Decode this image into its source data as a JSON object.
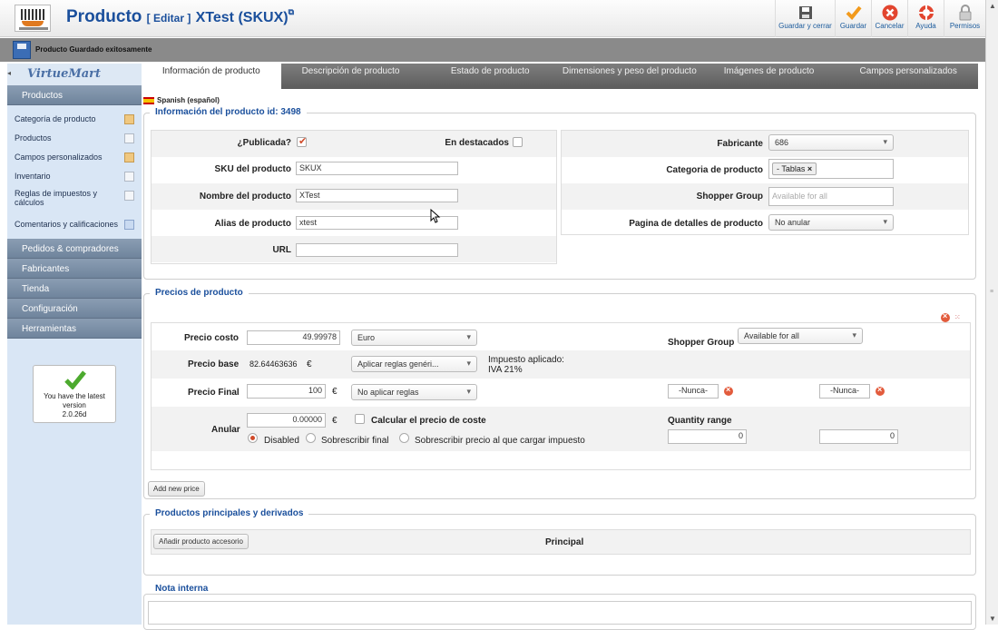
{
  "header": {
    "title": "Producto",
    "edit": "[ Editar ]",
    "product": "XTest (SKUX)",
    "toolbar": [
      {
        "label": "Guardar y cerrar",
        "icon": "save-close-icon"
      },
      {
        "label": "Guardar",
        "icon": "save-check-icon"
      },
      {
        "label": "Cancelar",
        "icon": "cancel-icon"
      },
      {
        "label": "Ayuda",
        "icon": "help-icon"
      },
      {
        "label": "Permisos",
        "icon": "lock-icon"
      }
    ]
  },
  "message": "Producto Guardado exitosamente",
  "sidebar": {
    "logo": "VirtueMart",
    "section_productos": "Productos",
    "items": [
      {
        "label": "Categoría de producto"
      },
      {
        "label": "Productos"
      },
      {
        "label": "Campos personalizados"
      },
      {
        "label": "Inventario"
      },
      {
        "label": "Reglas de impuestos y cálculos"
      },
      {
        "label": "Comentarios y calificaciones"
      }
    ],
    "sections": [
      "Pedidos & compradores",
      "Fabricantes",
      "Tienda",
      "Configuración",
      "Herramientas"
    ],
    "version_box": {
      "line1": "You have the latest",
      "line2": "version",
      "line3": "2.0.26d"
    }
  },
  "tabs": [
    "Información de producto",
    "Descripción de producto",
    "Estado de producto",
    "Dimensiones y peso del producto",
    "Imágenes de producto",
    "Campos personalizados"
  ],
  "info": {
    "language": "Spanish (español)",
    "legend": "Información del producto id: 3498",
    "publicada_label": "¿Publicada?",
    "destacados_label": "En destacados",
    "sku_label": "SKU del producto",
    "sku_value": "SKUX",
    "nombre_label": "Nombre del producto",
    "nombre_value": "XTest",
    "alias_label": "Alias de producto",
    "alias_value": "xtest",
    "url_label": "URL",
    "url_value": "",
    "fabricante_label": "Fabricante",
    "fabricante_value": "686",
    "categoria_label": "Categoria de producto",
    "categoria_tag": "- Tablas",
    "shopper_label": "Shopper Group",
    "shopper_placeholder": "Available for all",
    "pagina_label": "Pagina de detalles de producto",
    "pagina_value": "No anular"
  },
  "prices": {
    "legend": "Precios de producto",
    "costo_label": "Precio costo",
    "costo_value": "49.99978",
    "currency": "Euro",
    "shopper_label": "Shopper Group",
    "shopper_value": "Available for all",
    "base_label": "Precio base",
    "base_value": "82.64463636",
    "euro": "€",
    "base_rule": "Aplicar reglas genéri...",
    "tax_label": "Impuesto aplicado:",
    "tax_value": "IVA 21%",
    "final_label": "Precio Final",
    "final_value": "100",
    "final_rule": "No aplicar reglas",
    "nunca1": "-Nunca-",
    "nunca2": "-Nunca-",
    "anular_label": "Anular",
    "anular_value": "0.00000",
    "calc_label": "Calcular el precio de coste",
    "radio_disabled": "Disabled",
    "radio_final": "Sobrescribir final",
    "radio_carga": "Sobrescribir precio al que cargar impuesto",
    "qty_label": "Quantity range",
    "qty_from": "0",
    "qty_to": "0",
    "add_price": "Add new price"
  },
  "related": {
    "legend": "Productos principales y derivados",
    "add_button": "Añadir producto accesorio",
    "principal": "Principal"
  },
  "nota": {
    "legend": "Nota interna"
  }
}
